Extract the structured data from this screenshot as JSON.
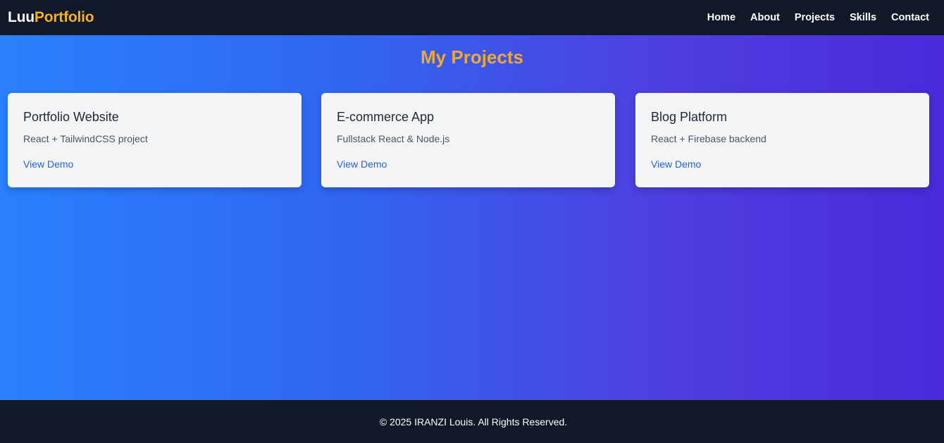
{
  "nav": {
    "logo_part1": "Luu",
    "logo_part2": "Portfolio",
    "links": [
      "Home",
      "About",
      "Projects",
      "Skills",
      "Contact"
    ]
  },
  "main": {
    "title": "My Projects",
    "projects": [
      {
        "title": "Portfolio Website",
        "description": "React + TailwindCSS project",
        "link": "View Demo"
      },
      {
        "title": "E-commerce App",
        "description": "Fullstack React & Node.js",
        "link": "View Demo"
      },
      {
        "title": "Blog Platform",
        "description": "React + Firebase backend",
        "link": "View Demo"
      }
    ]
  },
  "footer": {
    "text": "© 2025 IRANZI Louis. All Rights Reserved."
  },
  "colors": {
    "navbar": "#111827",
    "accent": "#f5b026",
    "card": "#f2f4f6",
    "link": "#2563c9",
    "gradient_start": "#2a80fd",
    "gradient_end": "#4a2ad9"
  }
}
